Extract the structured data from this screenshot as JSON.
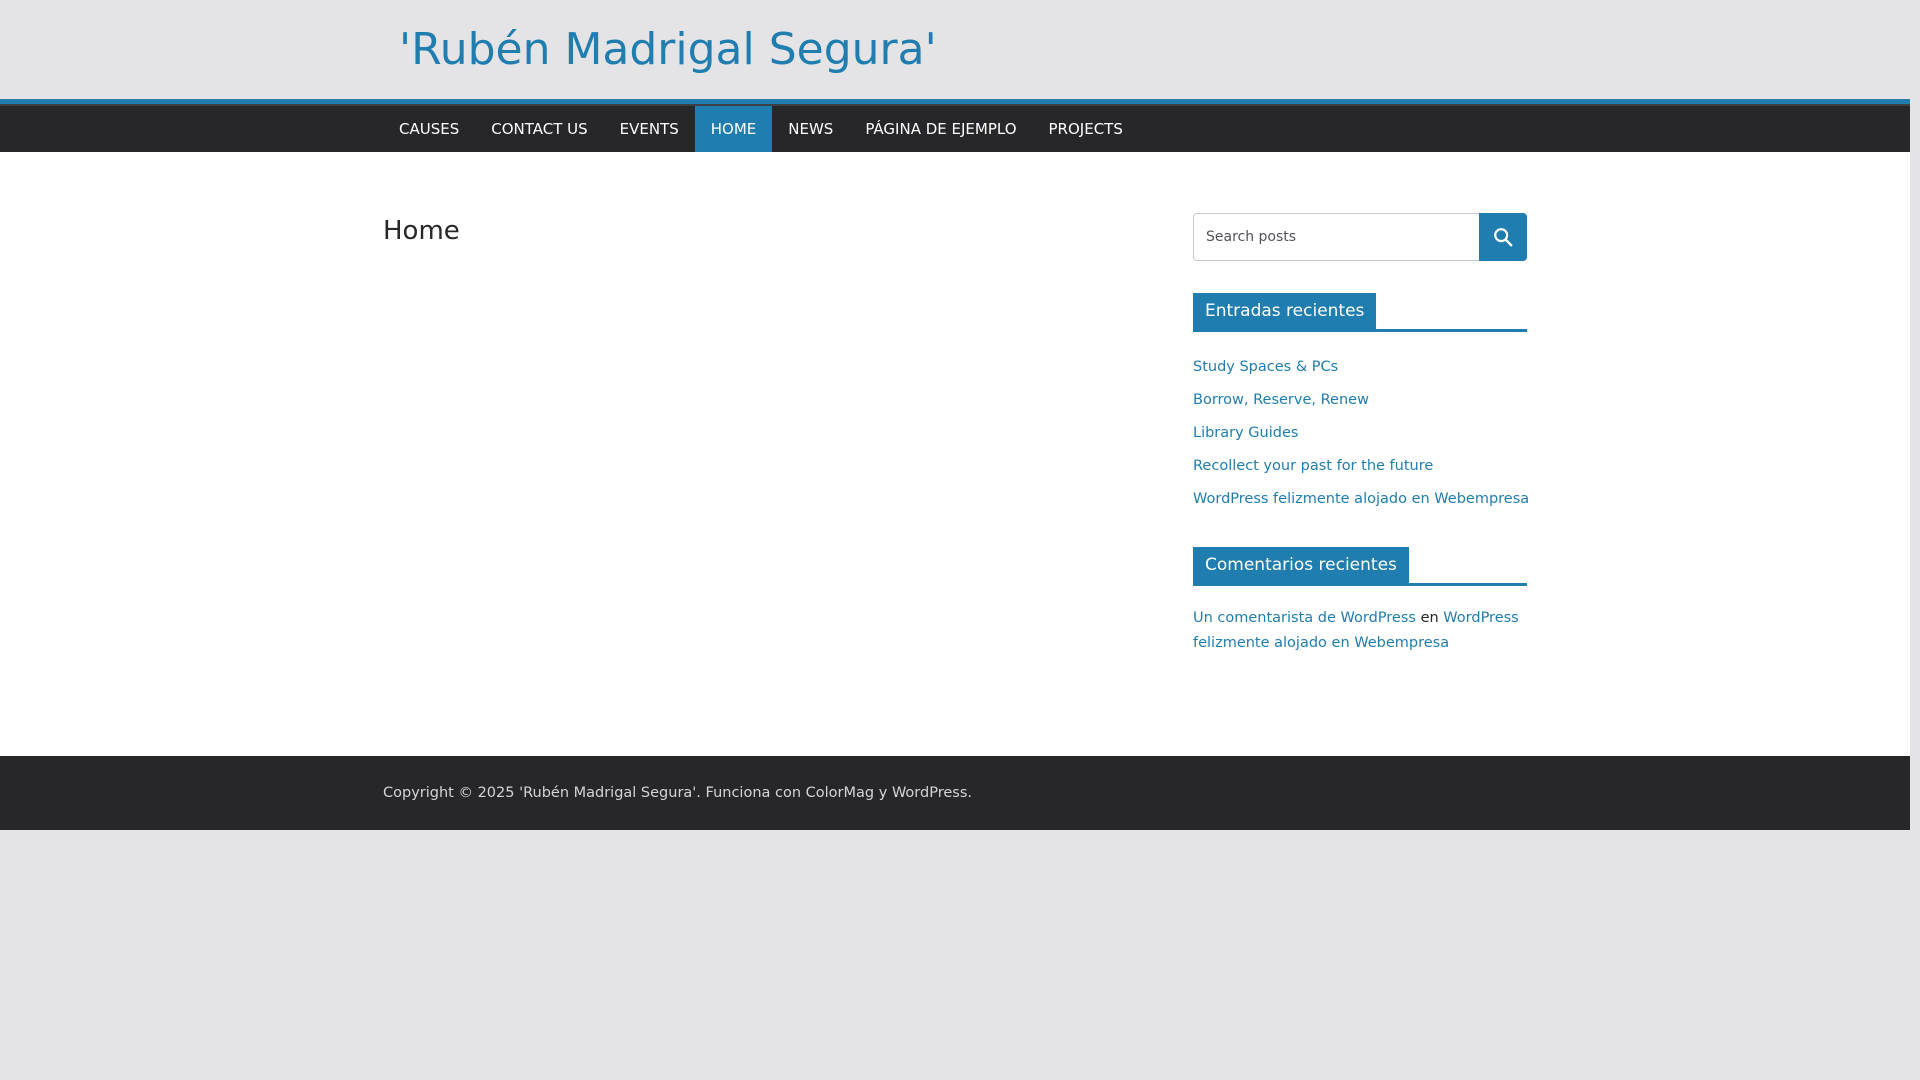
{
  "site": {
    "title": "'Rubén Madrigal Segura'"
  },
  "nav": {
    "items": [
      {
        "label": "CAUSES",
        "active": false
      },
      {
        "label": "CONTACT US",
        "active": false
      },
      {
        "label": "EVENTS",
        "active": false
      },
      {
        "label": "HOME",
        "active": true
      },
      {
        "label": "NEWS",
        "active": false
      },
      {
        "label": "PÁGINA DE EJEMPLO",
        "active": false
      },
      {
        "label": "PROJECTS",
        "active": false
      }
    ]
  },
  "main": {
    "heading": "Home"
  },
  "sidebar": {
    "search": {
      "placeholder": "Search posts",
      "button_icon": "search-icon"
    },
    "recent_posts": {
      "title": "Entradas recientes",
      "items": [
        "Study Spaces & PCs",
        "Borrow, Reserve, Renew",
        "Library Guides",
        "Recollect your past for the future",
        "WordPress felizmente alojado en Webempresa"
      ]
    },
    "recent_comments": {
      "title": "Comentarios recientes",
      "author": "Un comentarista de WordPress",
      "connector": "en",
      "post": "WordPress felizmente alojado en Webempresa"
    }
  },
  "footer": {
    "copyright_prefix": "Copyright © 2025 ",
    "site_link": "'Rubén Madrigal Segura'",
    "powered_text": ". Funciona con ",
    "theme_link": "ColorMag",
    "connector": " y ",
    "cms_link": "WordPress",
    "end": "."
  },
  "colors": {
    "accent": "#207daf",
    "nav_bg": "#27272a",
    "page_bg": "#e4e4e7",
    "content_bg": "#ffffff"
  }
}
